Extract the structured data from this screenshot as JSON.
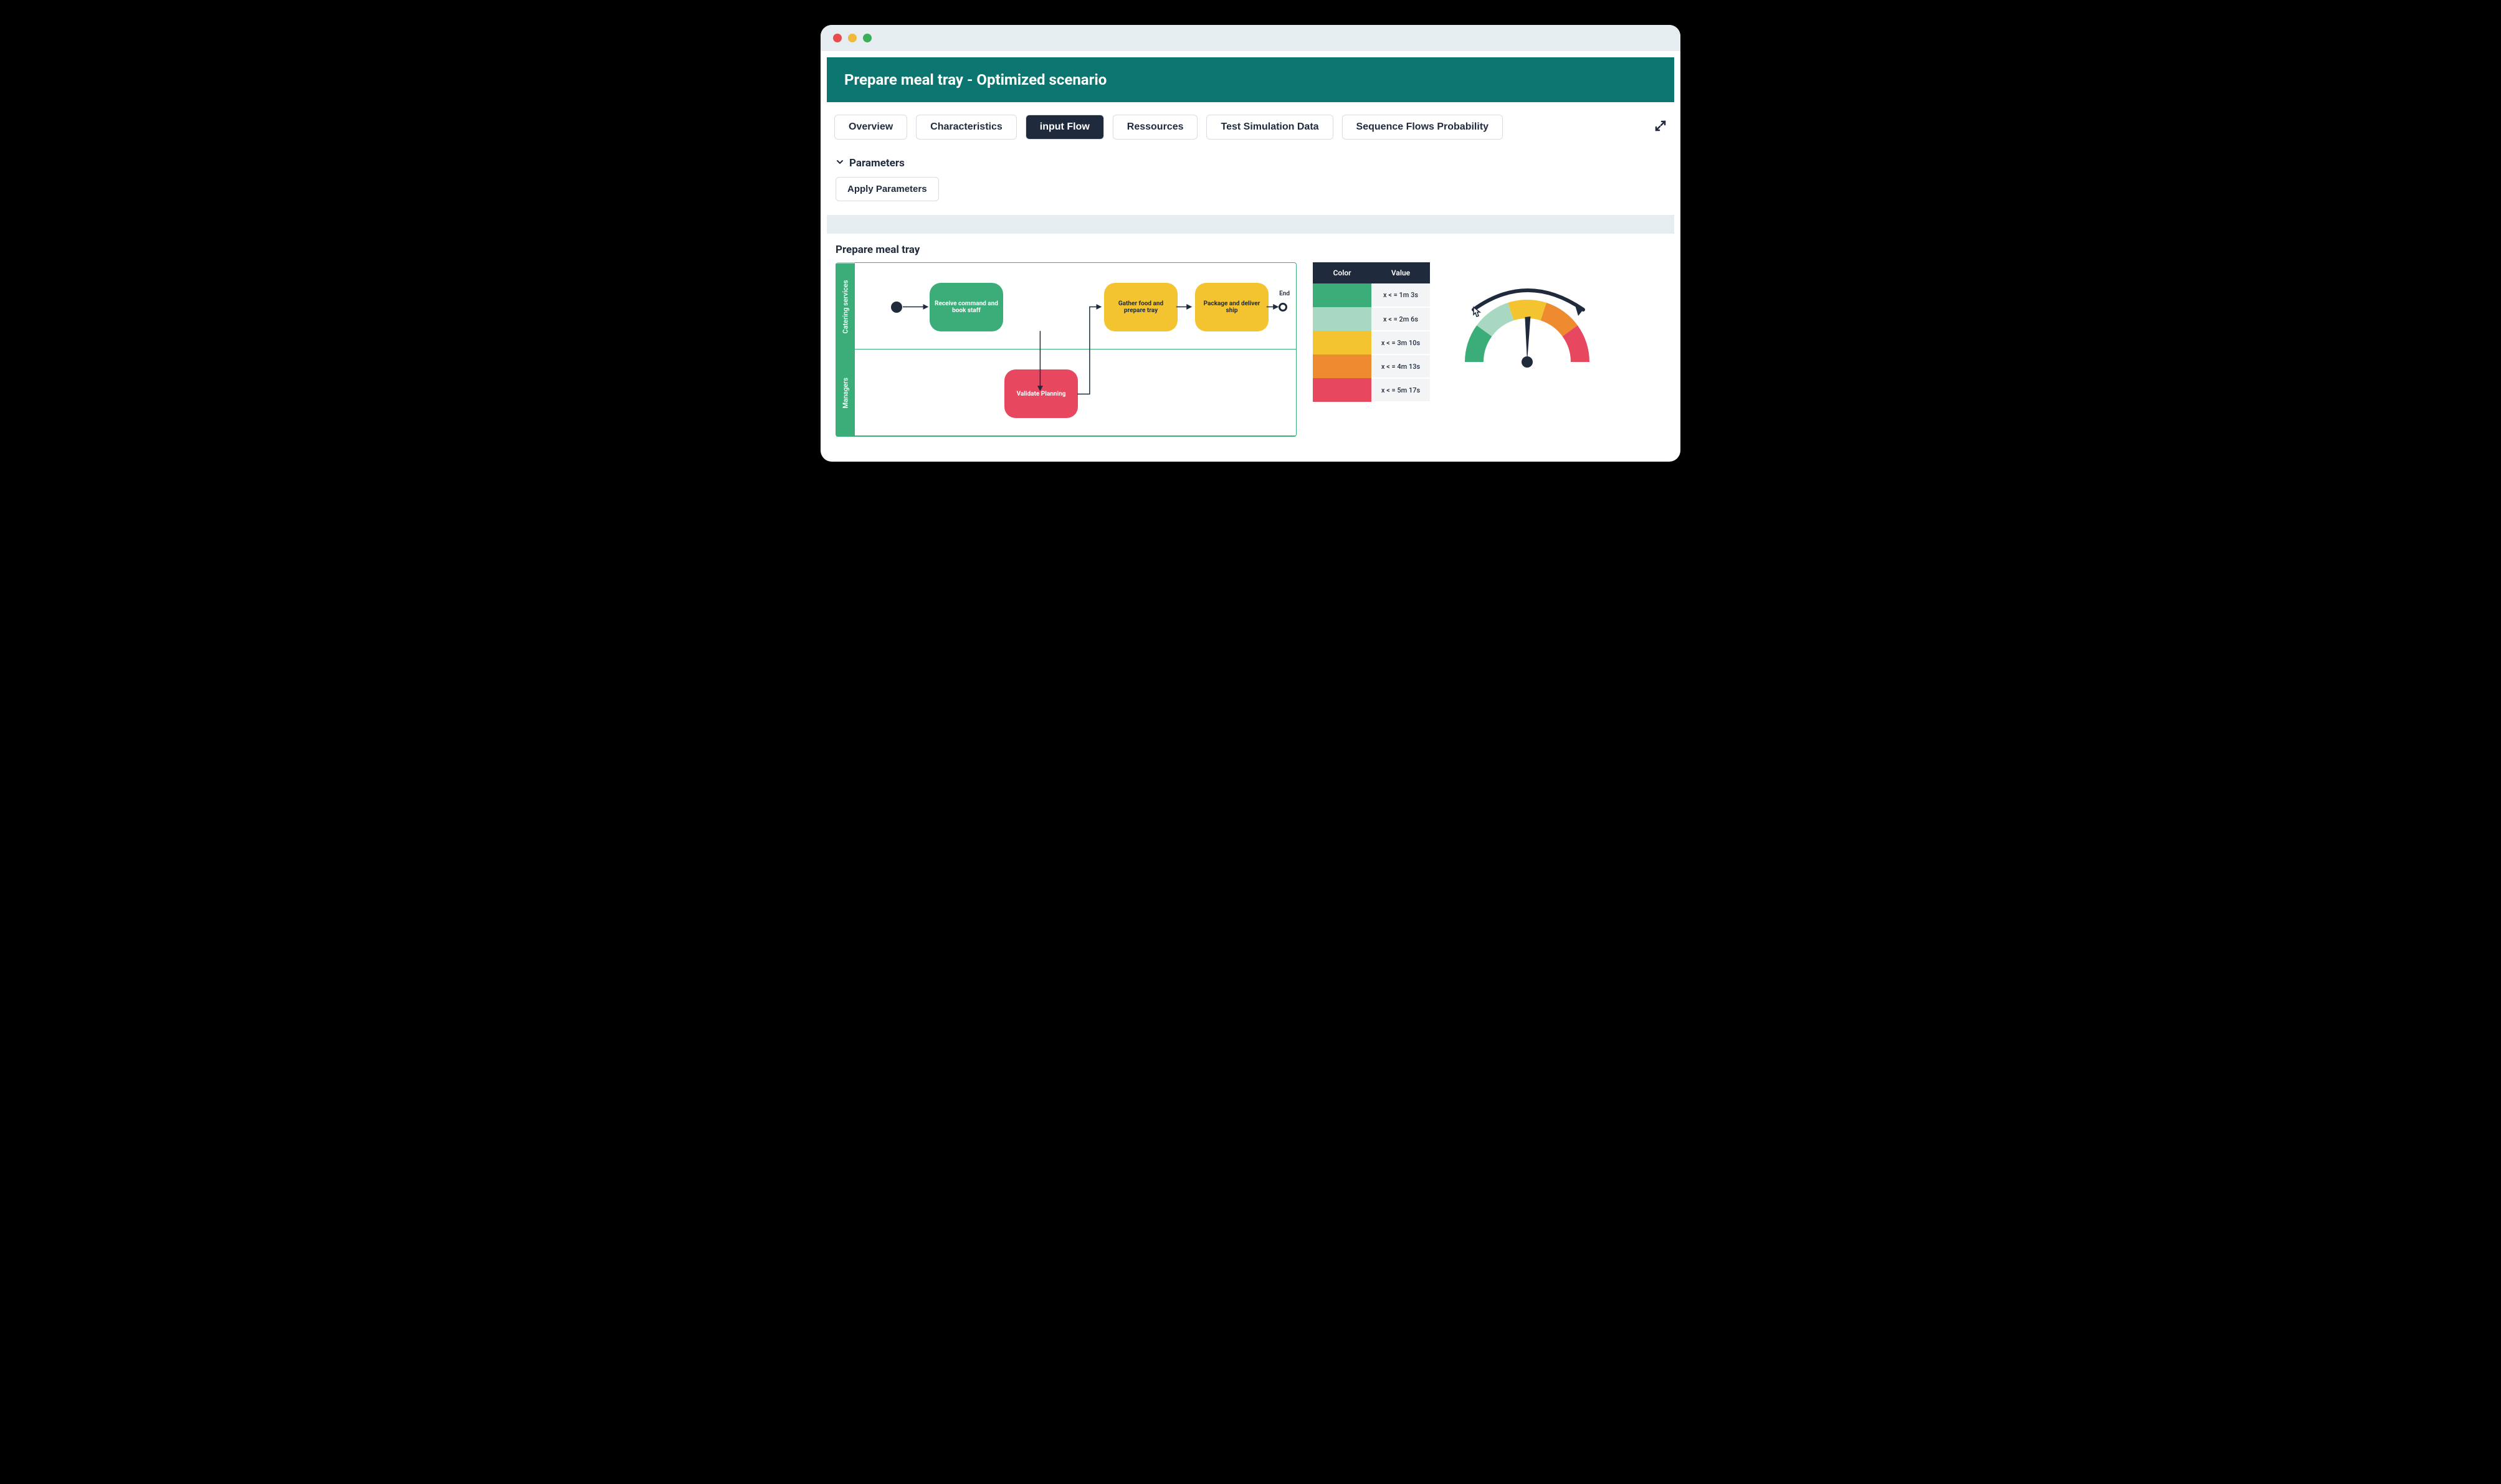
{
  "header": {
    "title": "Prepare meal tray - Optimized scenario"
  },
  "tabs": [
    {
      "label": "Overview",
      "active": false
    },
    {
      "label": "Characteristics",
      "active": false
    },
    {
      "label": "input Flow",
      "active": true
    },
    {
      "label": "Ressources",
      "active": false
    },
    {
      "label": "Test Simulation Data",
      "active": false
    },
    {
      "label": "Sequence Flows Probability",
      "active": false
    }
  ],
  "parameters": {
    "toggle_label": "Parameters",
    "apply_label": "Apply Parameters"
  },
  "diagram": {
    "title": "Prepare meal tray",
    "lanes": [
      "Catering services",
      "Managers"
    ],
    "end_label": "End",
    "tasks": {
      "receive": "Receive command and book staff",
      "validate": "Validate Planning",
      "gather": "Gather food and prepare tray",
      "package": "Package and deliver ship"
    }
  },
  "legend": {
    "headers": {
      "color": "Color",
      "value": "Value"
    },
    "rows": [
      {
        "color": "#3aad78",
        "value": "x < = 1m 3s"
      },
      {
        "color": "#a8d8c1",
        "value": "x < = 2m 6s"
      },
      {
        "color": "#f4c430",
        "value": "x < = 3m 10s"
      },
      {
        "color": "#ed8b2e",
        "value": "x < = 4m 13s"
      },
      {
        "color": "#e8485f",
        "value": "x < = 5m 17s"
      }
    ]
  },
  "colors": {
    "teal": "#0c756f",
    "dark": "#1f2b3d"
  }
}
